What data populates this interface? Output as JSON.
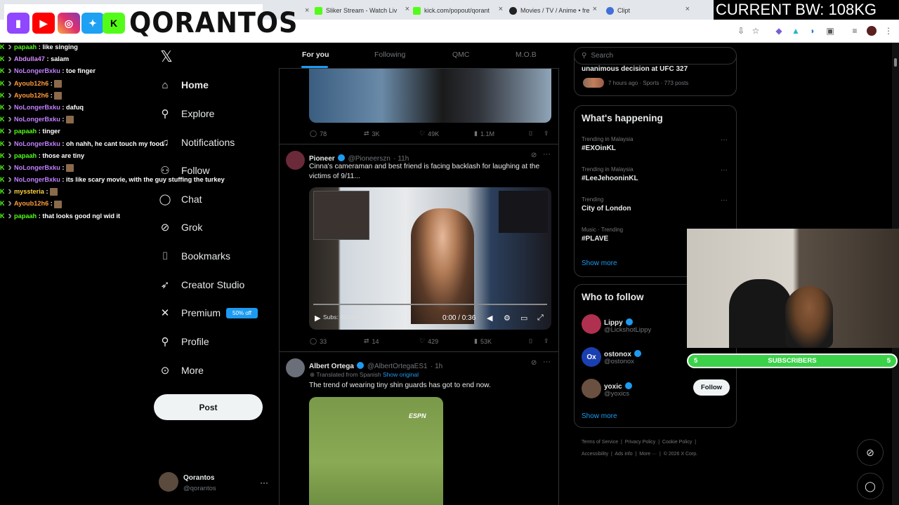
{
  "browser": {
    "tabs": [
      {
        "title": "Sliker Stream - Watch Liv",
        "fav": "#53fc18"
      },
      {
        "title": "kick.com/popout/qorant",
        "fav": "#53fc18"
      },
      {
        "title": "Movies / TV / Anime • fre",
        "fav": "#222222"
      },
      {
        "title": "Clipt",
        "fav": "#3f6fd8"
      }
    ],
    "overlay_bw": "CURRENT BW: 108KG"
  },
  "stream": {
    "brand_name": "QORANTOS",
    "subscribers_label": "SUBSCRIBERS",
    "subscribers_left": "5",
    "subscribers_right": "5"
  },
  "chat": [
    {
      "user": "papaah",
      "color": "#53fc18",
      "text": ": like singing",
      "emote": false
    },
    {
      "user": "Abdulla47",
      "color": "#d48cff",
      "text": ": salam",
      "emote": false
    },
    {
      "user": "NoLongerBxku",
      "color": "#c080ff",
      "text": ": toe finger",
      "emote": false
    },
    {
      "user": "Ayoub12h6",
      "color": "#ff9a3c",
      "text": ":",
      "emote": true
    },
    {
      "user": "Ayoub12h6",
      "color": "#ff9a3c",
      "text": ":",
      "emote": true
    },
    {
      "user": "NoLongerBxku",
      "color": "#c080ff",
      "text": ": dafuq",
      "emote": false
    },
    {
      "user": "NoLongerBxku",
      "color": "#c080ff",
      "text": ":",
      "emote": true
    },
    {
      "user": "papaah",
      "color": "#53fc18",
      "text": ": tinger",
      "emote": false
    },
    {
      "user": "NoLongerBxku",
      "color": "#c080ff",
      "text": ": oh nahh, he cant touch my food",
      "emote": false
    },
    {
      "user": "papaah",
      "color": "#53fc18",
      "text": ": those are tiny",
      "emote": false
    },
    {
      "user": "NoLongerBxku",
      "color": "#c080ff",
      "text": ":",
      "emote": true
    },
    {
      "user": "NoLongerBxku",
      "color": "#c080ff",
      "text": ": its like scary movie, with the guy stuffing the turkey",
      "emote": false
    },
    {
      "user": "myssteria",
      "color": "#ffd23c",
      "text": ":",
      "emote": true
    },
    {
      "user": "Ayoub12h6",
      "color": "#ff9a3c",
      "text": ":",
      "emote": true
    },
    {
      "user": "papaah",
      "color": "#53fc18",
      "text": ": that looks good ngl wid it",
      "emote": false
    }
  ],
  "nav": {
    "home": "Home",
    "explore": "Explore",
    "notifications": "Notifications",
    "follow": "Follow",
    "chat": "Chat",
    "grok": "Grok",
    "bookmarks": "Bookmarks",
    "creator_studio": "Creator Studio",
    "premium": "Premium",
    "premium_badge": "50% off",
    "profile": "Profile",
    "more": "More",
    "post": "Post",
    "account_name": "Qorantos",
    "account_handle": "@qorantos"
  },
  "feed": {
    "tabs": [
      "For you",
      "Following",
      "QMC",
      "M.O.B"
    ],
    "post0": {
      "replies": "78",
      "reposts": "3K",
      "likes": "49K",
      "views": "1.1M"
    },
    "post1": {
      "name": "Pioneer",
      "handle": "@Pioneerszn",
      "time": "· 11h",
      "text": "Cinna's cameraman and best friend is facing backlash for laughing at the victims of 9/11...",
      "video_time": "0:00 / 0:36",
      "video_overlay": "Subs: 800/idk",
      "replies": "33",
      "reposts": "14",
      "likes": "429",
      "views": "53K"
    },
    "post2": {
      "name": "Albert Ortega",
      "handle": "@AlbertOrtegaES1",
      "time": "· 1h",
      "translated": "Translated from Spanish",
      "show_original": "Show original",
      "text": "The trend of wearing tiny shin guards has got to end now.",
      "media_label": "ESPN"
    }
  },
  "sidebar": {
    "search_placeholder": "Search",
    "news_title": "unanimous decision at UFC 327",
    "news_meta": "7 hours ago · Sports · 773 posts",
    "happening_title": "What's happening",
    "trends": [
      {
        "meta": "Trending in Malaysia",
        "name": "#EXOinKL"
      },
      {
        "meta": "Trending in Malaysia",
        "name": "#LeeJehooninKL"
      },
      {
        "meta": "Trending",
        "name": "City of London"
      },
      {
        "meta": "Music · Trending",
        "name": "#PLAVE"
      }
    ],
    "show_more": "Show more",
    "wtf_title": "Who to follow",
    "wtf": [
      {
        "name": "Lippy",
        "handle": "@LickshotLippy"
      },
      {
        "name": "ostonox",
        "handle": "@ostonox"
      },
      {
        "name": "yoxic",
        "handle": "@yoxics"
      }
    ],
    "follow_label": "Follow",
    "footer_line1": [
      "Terms of Service",
      "Privacy Policy",
      "Cookie Policy"
    ],
    "footer_line2": [
      "Accessibility",
      "Ads info",
      "More ···",
      "© 2026 X Corp."
    ]
  }
}
